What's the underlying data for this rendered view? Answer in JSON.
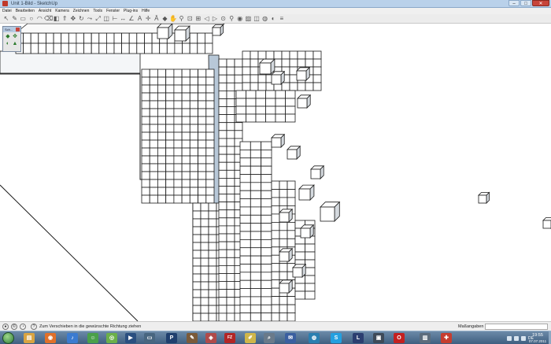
{
  "window": {
    "title": "Unit 1-Bild - SketchUp",
    "minimize": "–",
    "maximize": "□",
    "close": "✕"
  },
  "menu": [
    "Datei",
    "Bearbeiten",
    "Ansicht",
    "Kamera",
    "Zeichnen",
    "Tools",
    "Fenster",
    "Plug-ins",
    "Hilfe"
  ],
  "toolbar": {
    "tools": [
      "select-icon",
      "pencil-icon",
      "rectangle-icon",
      "circle-icon",
      "arc-icon",
      "eraser-icon",
      "paint-bucket-icon",
      "push-pull-icon",
      "move-icon",
      "rotate-icon",
      "follow-me-icon",
      "scale-icon",
      "offset-icon",
      "tape-measure-icon",
      "dimension-icon",
      "protractor-icon",
      "text-icon",
      "axes-icon",
      "3d-text-icon",
      "orbit-icon",
      "pan-icon",
      "zoom-icon",
      "zoom-window-icon",
      "zoom-extents-icon",
      "previous-view-icon",
      "next-view-icon",
      "position-camera-icon",
      "walk-icon",
      "look-around-icon",
      "section-plane-icon",
      "components-icon",
      "materials-icon",
      "styles-icon",
      "layers-icon"
    ]
  },
  "floating_toolbar": {
    "title": "Sch..."
  },
  "status": {
    "hint": "Zum Verschieben in die gewünschte Richtung ziehen",
    "measure_label": "Maßangaben",
    "measure_value": ""
  },
  "taskbar": {
    "apps": [
      {
        "name": "explorer-icon",
        "color": "#d9a441",
        "glyph": "▤"
      },
      {
        "name": "firefox-icon",
        "color": "#e0702a",
        "glyph": "◉"
      },
      {
        "name": "itunes-icon",
        "color": "#3b7bd0",
        "glyph": "♪"
      },
      {
        "name": "messenger-icon",
        "color": "#4aa04a",
        "glyph": "☺"
      },
      {
        "name": "skype-icon",
        "color": "#6bb04a",
        "glyph": "◎"
      },
      {
        "name": "media-player-icon",
        "color": "#2a4f80",
        "glyph": "▶"
      },
      {
        "name": "monitor-icon",
        "color": "#486680",
        "glyph": "▭"
      },
      {
        "name": "photoshop-icon",
        "color": "#1f3f6e",
        "glyph": "P"
      },
      {
        "name": "pen-tool-icon",
        "color": "#7a5a3a",
        "glyph": "✎"
      },
      {
        "name": "color-picker-icon",
        "color": "#b04a4a",
        "glyph": "◈"
      },
      {
        "name": "filezilla-icon",
        "color": "#b32626",
        "glyph": "FZ"
      },
      {
        "name": "notes-icon",
        "color": "#cfb64a",
        "glyph": "✐"
      },
      {
        "name": "search-icon",
        "color": "#6a7a8a",
        "glyph": "⌕"
      },
      {
        "name": "thunderbird-icon",
        "color": "#3a5fa0",
        "glyph": "✉"
      },
      {
        "name": "globe-icon",
        "color": "#2a7fb0",
        "glyph": "◍"
      },
      {
        "name": "skype-call-icon",
        "color": "#23a0e0",
        "glyph": "S"
      },
      {
        "name": "league-icon",
        "color": "#2b3e70",
        "glyph": "L"
      },
      {
        "name": "game-client-icon",
        "color": "#3e4a58",
        "glyph": "▣"
      },
      {
        "name": "opera-icon",
        "color": "#c42020",
        "glyph": "O"
      },
      {
        "name": "mail-icon",
        "color": "#5c6c7c",
        "glyph": "▥"
      },
      {
        "name": "sketchup-icon",
        "color": "#c63d2f",
        "glyph": "✚"
      }
    ],
    "language": "DE",
    "time": "19:55",
    "date": "07.07.2011"
  },
  "colors": {
    "face": "#ffffff",
    "edge": "#1a1a1a",
    "shade": "#d4d9de",
    "accent_blue": "#b8c8d8"
  }
}
